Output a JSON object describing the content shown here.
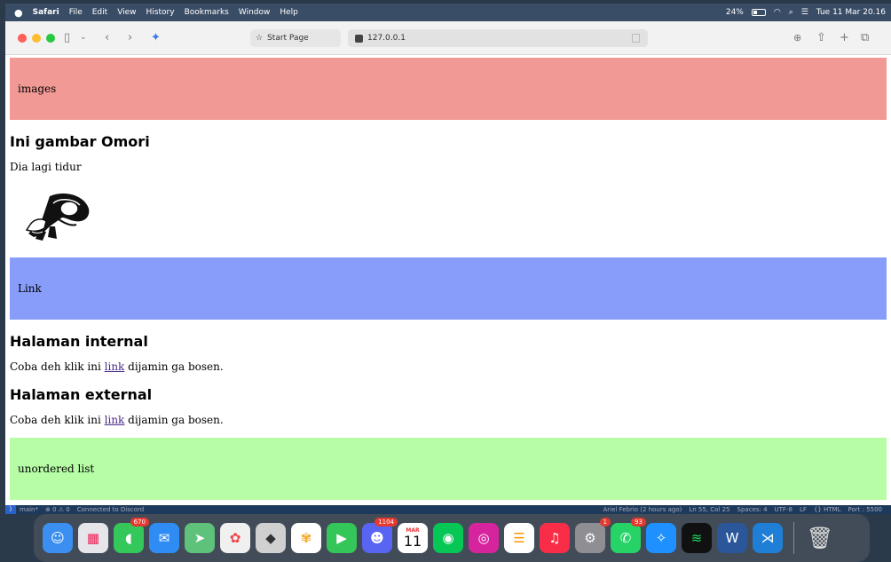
{
  "menubar": {
    "apple": "",
    "items": [
      "Safari",
      "File",
      "Edit",
      "View",
      "History",
      "Bookmarks",
      "Window",
      "Help"
    ],
    "battery": "24%",
    "datetime": "Tue 11 Mar 20.16"
  },
  "browser": {
    "tab_label": "Start Page",
    "url": "127.0.0.1"
  },
  "page": {
    "images_section": "images",
    "image_title": "Ini gambar Omori",
    "image_caption": "Dia lagi tidur",
    "link_section": "Link",
    "internal_title": "Halaman internal",
    "internal_prefix": "Coba deh klik ini ",
    "internal_link": "link",
    "internal_suffix": " dijamin ga bosen.",
    "external_title": "Halaman external",
    "external_prefix": "Coba deh klik ini ",
    "external_link": "link",
    "external_suffix": " dijamin ga bosen.",
    "list_section": "unordered list"
  },
  "statusbar": {
    "branch": "main*",
    "problems": "⊗ 0 ⚠ 0",
    "discord": "Connected to Discord",
    "blame": "Ariel Febrio (2 hours ago)",
    "position": "Ln 55, Col 25",
    "spaces": "Spaces: 4",
    "encoding": "UTF-8",
    "eol": "LF",
    "language": "{} HTML",
    "port": "Port : 5500"
  },
  "dock": {
    "badges": {
      "messages": "670",
      "discord": "1104",
      "settings": "1",
      "whatsapp": "93"
    },
    "calendar_month": "MAR",
    "calendar_day": "11",
    "apps": [
      "finder",
      "launchpad",
      "messages",
      "mail",
      "maps",
      "photos-alt",
      "roblox",
      "photos",
      "facetime",
      "discord",
      "calendar",
      "line",
      "instagram",
      "reminders",
      "music",
      "system-settings",
      "whatsapp",
      "safari",
      "spotify",
      "word",
      "vscode",
      "trash"
    ]
  }
}
